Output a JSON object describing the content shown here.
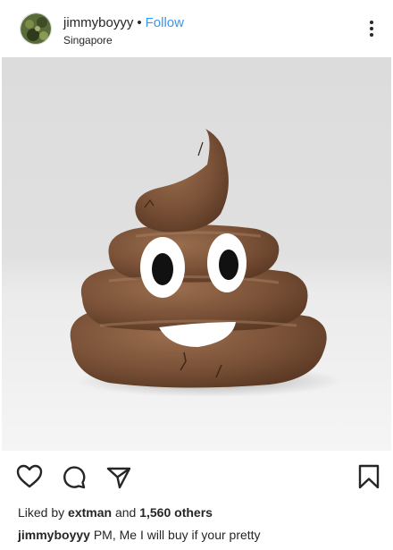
{
  "header": {
    "username": "jimmyboyyy",
    "separator": "•",
    "follow_label": "Follow",
    "location": "Singapore"
  },
  "likes": {
    "prefix": "Liked by",
    "first_user": "extman",
    "joiner": "and",
    "others": "1,560 others"
  },
  "caption": {
    "username": "jimmyboyyy",
    "text": "PM, Me I will buy if your pretty"
  },
  "icons": {
    "more": "more-options-icon",
    "like": "heart-icon",
    "comment": "comment-icon",
    "share": "share-icon",
    "save": "bookmark-icon"
  },
  "colors": {
    "accent": "#3897f0",
    "text": "#262626"
  }
}
